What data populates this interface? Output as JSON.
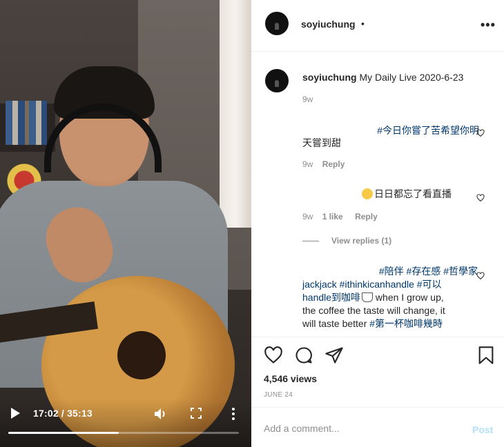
{
  "video": {
    "time": "17:02 / 35:13",
    "progress": 0.48,
    "play_icon": "play-icon",
    "volume_icon": "volume-icon",
    "fullscreen_icon": "fullscreen-icon",
    "more_icon": "more-vertical-icon"
  },
  "header": {
    "username": "soyiuchung",
    "dot": "•",
    "more": "•••"
  },
  "caption": {
    "username": "soyiuchung",
    "text": " My Daily Live 2020-6-23",
    "age": "9w"
  },
  "comments": [
    {
      "tag": "#今日你嘗了苦希望你明",
      "line2": "天嘗到甜",
      "age": "9w",
      "reply": "Reply"
    },
    {
      "text": "日日都忘了看直播",
      "age": "9w",
      "likes": "1 like",
      "reply": "Reply"
    },
    {
      "tags_line1": "#陪伴 #存在感 #哲學家",
      "tags_line2": "jackjack #ithinkicanhandle #可以",
      "tags_line3": "handle到咖啡",
      "text3": " when I grow up,",
      "line4": "the coffee the taste will change, it",
      "line5": "will taste better ",
      "tag5": "#第一杯咖啡幾時"
    }
  ],
  "view_replies": "View replies (1)",
  "actions": {
    "views": "4,546 views",
    "date": "JUNE 24"
  },
  "add_comment": {
    "placeholder": "Add a comment...",
    "post": "Post"
  },
  "colors": {
    "text": "#262626",
    "muted": "#8e8e8e",
    "hashtag": "#00376b",
    "post_disabled": "#b2dffc"
  }
}
